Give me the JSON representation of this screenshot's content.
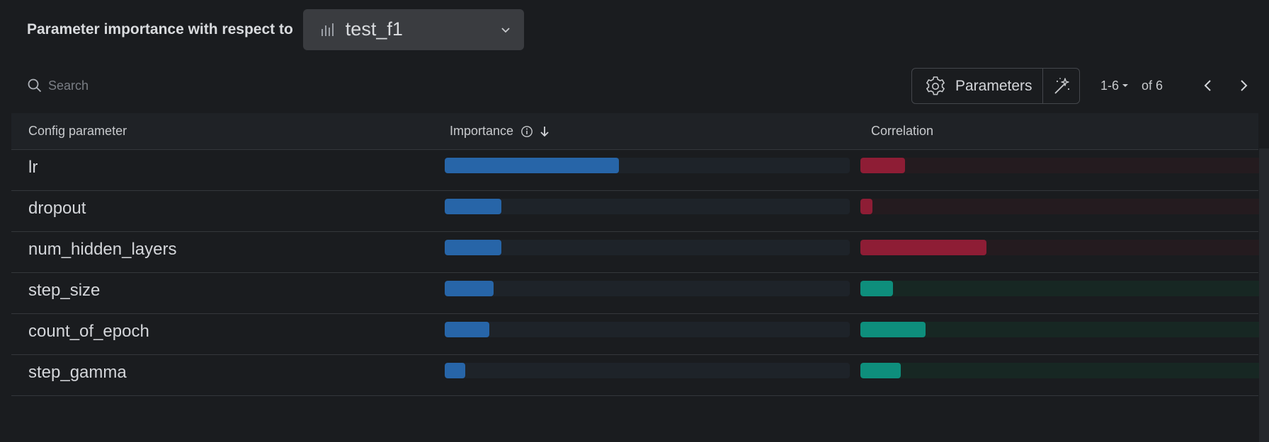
{
  "header": {
    "label": "Parameter importance with respect to",
    "metric": "test_f1",
    "metric_icon": "bar-chart-icon",
    "dropdown_icon": "chevron-down-icon"
  },
  "toolbar": {
    "search_placeholder": "Search",
    "parameters_label": "Parameters",
    "parameters_icon": "gear-icon",
    "magic_icon": "magic-wand-icon",
    "page_range": "1-6",
    "page_of": "of 6"
  },
  "table": {
    "columns": [
      "Config parameter",
      "Importance",
      "Correlation"
    ],
    "sort": "importance-descending",
    "rows": [
      {
        "name": "lr",
        "importance": 0.43,
        "correlation": -0.11
      },
      {
        "name": "dropout",
        "importance": 0.14,
        "correlation": -0.03
      },
      {
        "name": "num_hidden_layers",
        "importance": 0.14,
        "correlation": -0.31
      },
      {
        "name": "step_size",
        "importance": 0.12,
        "correlation": 0.08
      },
      {
        "name": "count_of_epoch",
        "importance": 0.11,
        "correlation": 0.16
      },
      {
        "name": "step_gamma",
        "importance": 0.05,
        "correlation": 0.1
      }
    ]
  },
  "colors": {
    "background": "#1a1c1f",
    "importance_bar": "#2765a8",
    "correlation_negative": "#8e1d35",
    "correlation_positive": "#0e8e7c"
  }
}
